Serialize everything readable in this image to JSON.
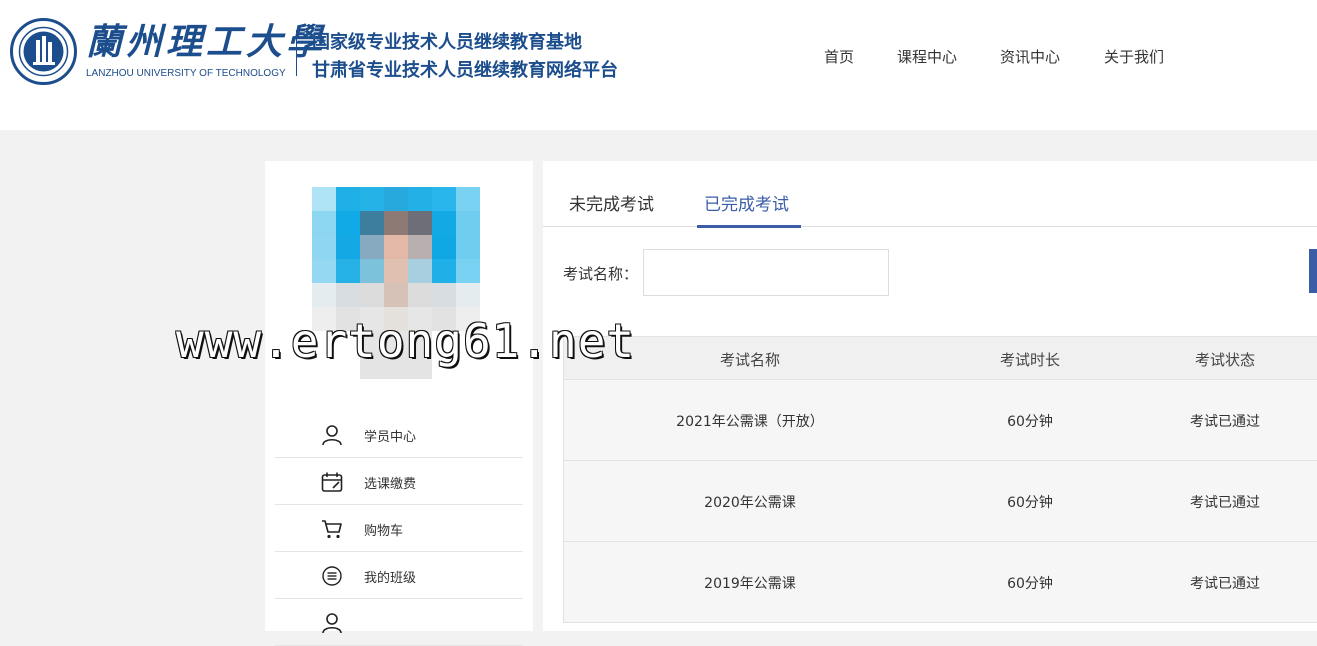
{
  "header": {
    "logo_cn": "蘭州理工大學",
    "logo_en": "LANZHOU UNIVERSITY OF TECHNOLOGY",
    "subtitle_line1": "国家级专业技术人员继续教育基地",
    "subtitle_line2": "甘肃省专业技术人员继续教育网络平台",
    "nav": [
      "首页",
      "课程中心",
      "资讯中心",
      "关于我们"
    ],
    "brand_color": "#1c4d8c"
  },
  "sidebar": {
    "menu": [
      {
        "label": "学员中心",
        "icon": "user-icon"
      },
      {
        "label": "选课缴费",
        "icon": "calendar-icon"
      },
      {
        "label": "购物车",
        "icon": "cart-icon"
      },
      {
        "label": "我的班级",
        "icon": "list-icon"
      },
      {
        "label": "",
        "icon": "user-icon"
      }
    ]
  },
  "main": {
    "tabs": [
      "未完成考试",
      "已完成考试"
    ],
    "active_tab": "已完成考试",
    "search": {
      "label": "考试名称：",
      "value": ""
    },
    "table": {
      "columns": [
        "考试名称",
        "考试时长",
        "考试状态"
      ],
      "rows": [
        [
          "2021年公需课（开放）",
          "60分钟",
          "考试已通过"
        ],
        [
          "2020年公需课",
          "60分钟",
          "考试已通过"
        ],
        [
          "2019年公需课",
          "60分钟",
          "考试已通过"
        ]
      ]
    },
    "accent_color": "#3b5da8"
  },
  "watermark": "www.ertong61.net"
}
